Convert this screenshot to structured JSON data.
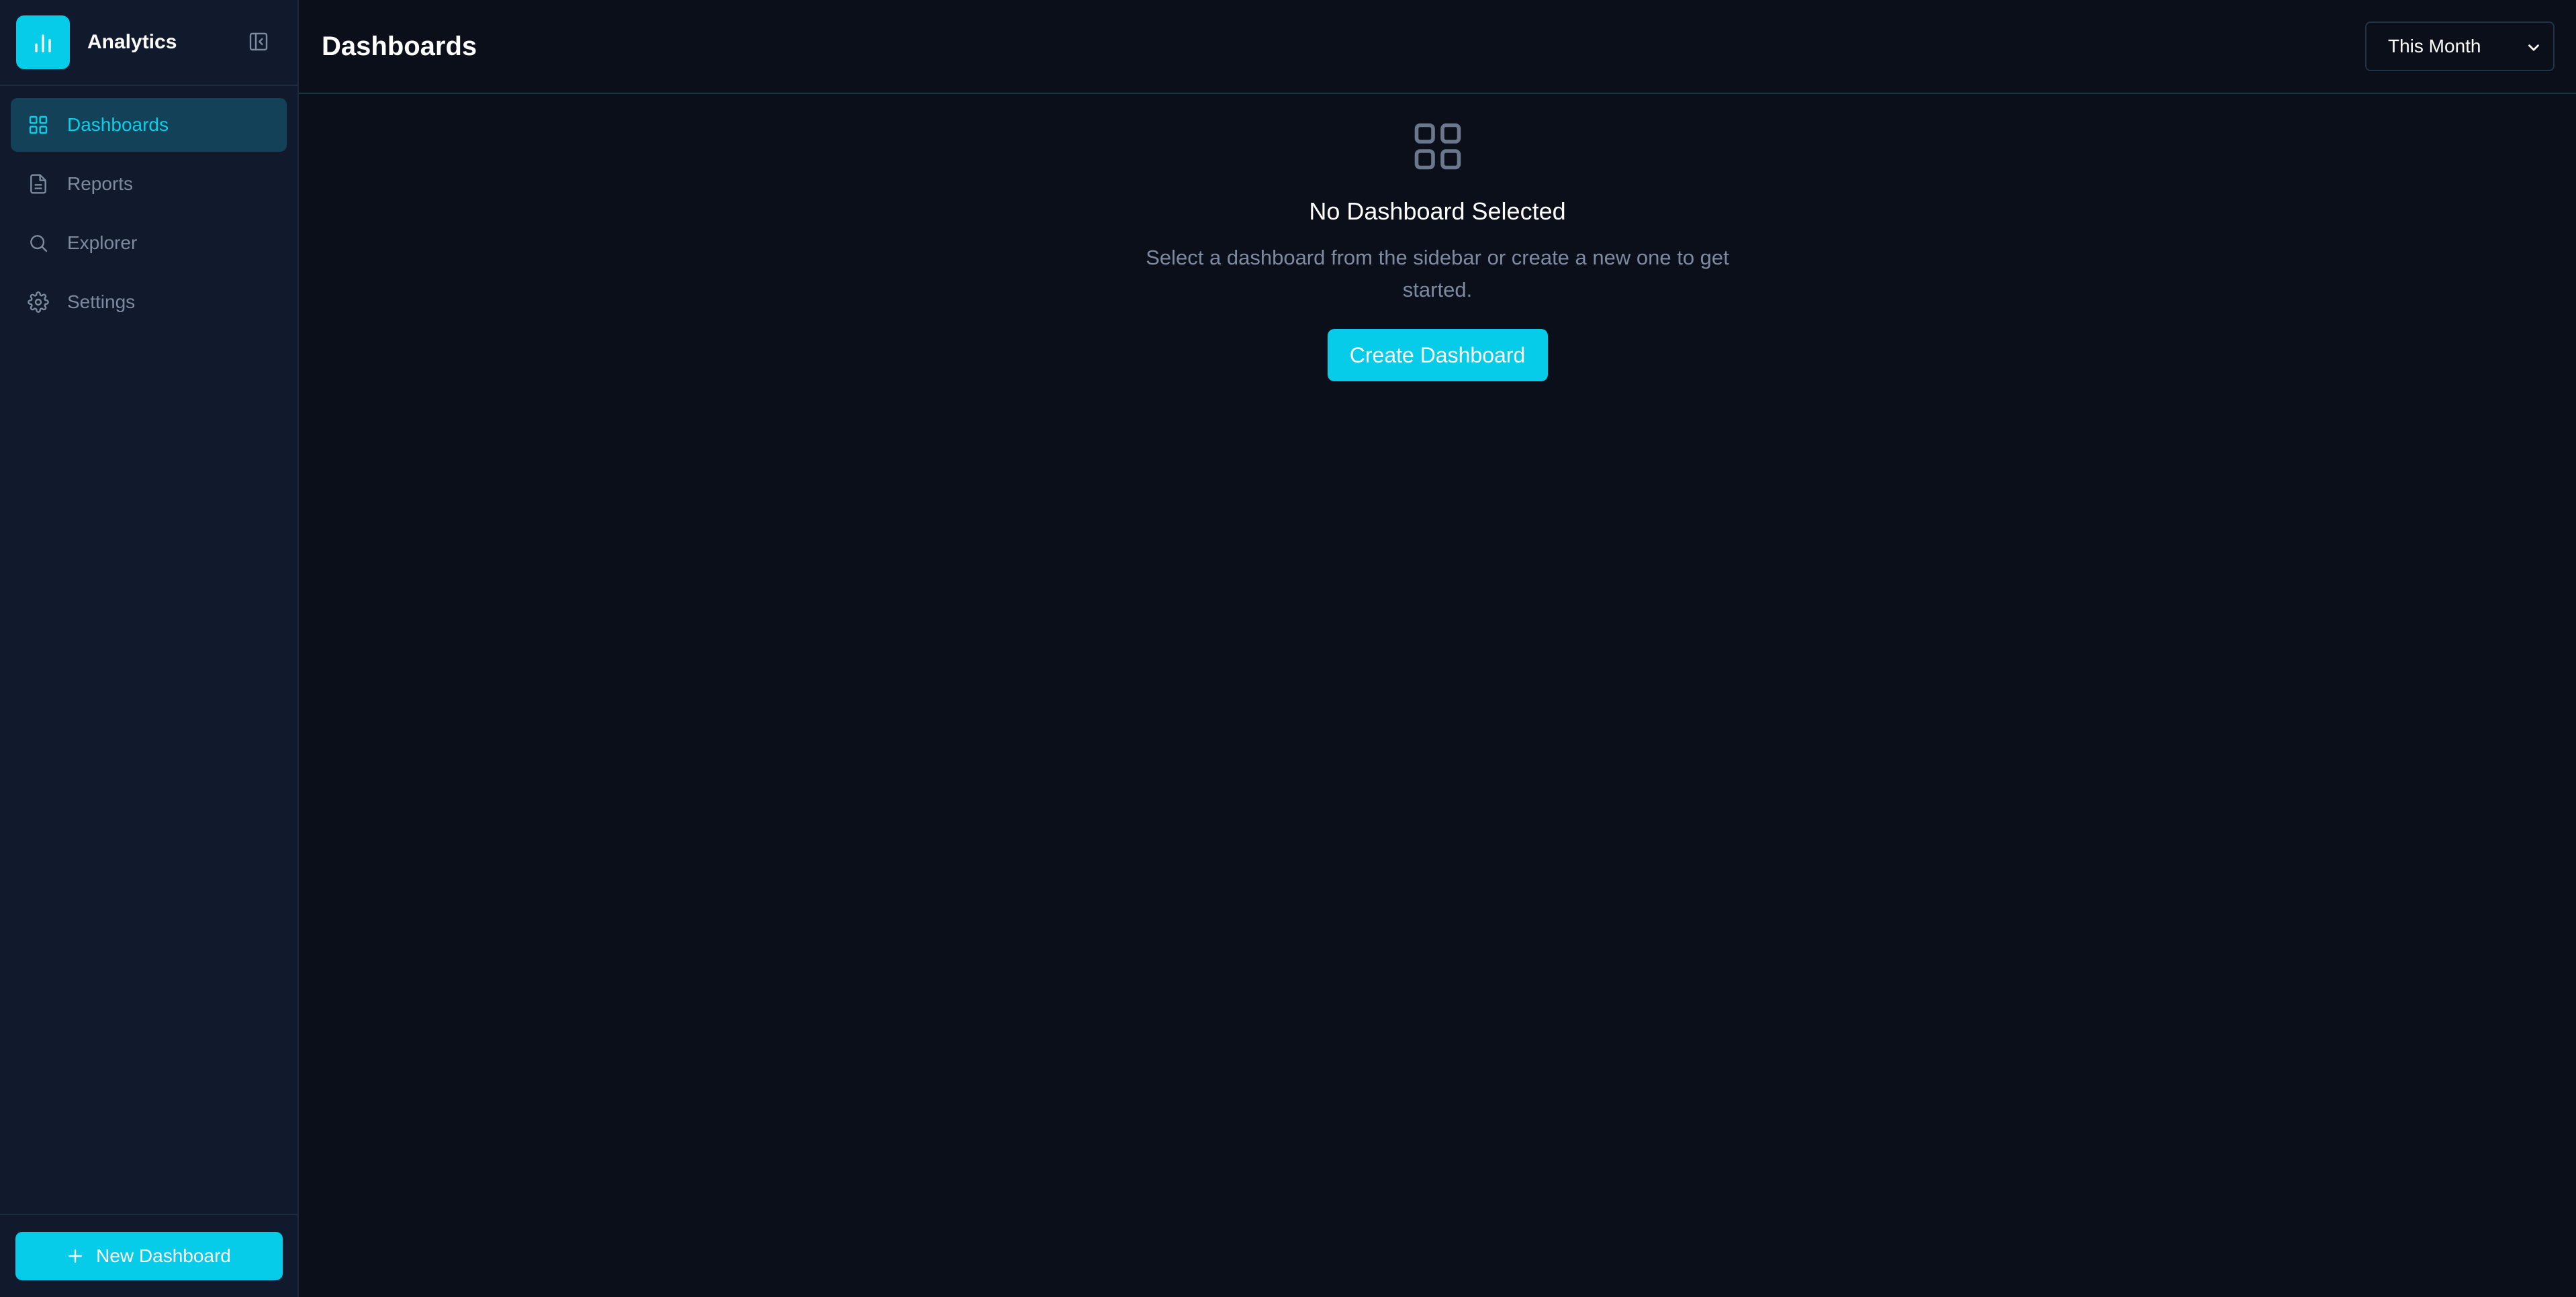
{
  "brand": {
    "name": "Analytics",
    "logo_icon": "bar-chart-icon"
  },
  "sidebar": {
    "items": [
      {
        "label": "Dashboards",
        "icon": "grid-icon",
        "active": true
      },
      {
        "label": "Reports",
        "icon": "document-icon",
        "active": false
      },
      {
        "label": "Explorer",
        "icon": "search-icon",
        "active": false
      },
      {
        "label": "Settings",
        "icon": "gear-icon",
        "active": false
      }
    ],
    "new_dashboard_label": "New Dashboard"
  },
  "header": {
    "title": "Dashboards",
    "range_select": {
      "selected": "This Month"
    }
  },
  "empty_state": {
    "title": "No Dashboard Selected",
    "description": "Select a dashboard from the sidebar or create a new one to get started.",
    "button_label": "Create Dashboard"
  },
  "colors": {
    "accent": "#06cbe9",
    "background": "#0a0f1a",
    "sidebar": "#111a2c",
    "active_item_bg": "#134158",
    "muted_text": "#7d8aa0"
  }
}
